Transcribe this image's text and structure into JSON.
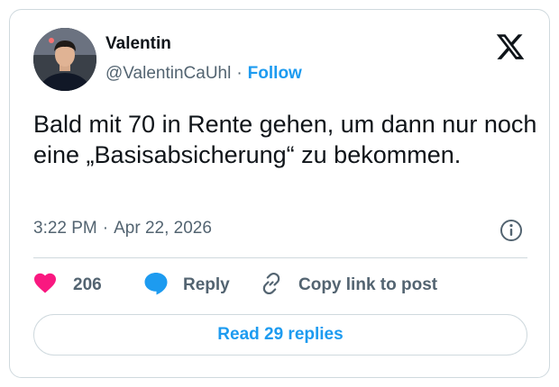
{
  "author": {
    "name": "Valentin",
    "handle": "@ValentinCaUhl",
    "separator": "·",
    "follow_label": "Follow"
  },
  "tweet": {
    "text": "Bald mit 70 in Rente gehen, um dann nur noch eine „Basisabsicherung“ zu bekommen.",
    "time": "3:22 PM",
    "separator": "·",
    "date": "Apr 22, 2026"
  },
  "actions": {
    "likes_count": "206",
    "reply_label": "Reply",
    "copy_label": "Copy link to post"
  },
  "read_replies_label": "Read 29 replies",
  "icons": {
    "brand": "x-logo-icon",
    "info": "info-icon",
    "like": "heart-icon",
    "reply": "speech-bubble-icon",
    "copy": "link-icon"
  },
  "colors": {
    "accent": "#1d9bf0",
    "like": "#f91880",
    "text": "#0f1419",
    "secondary": "#536471",
    "border": "#cfd9de"
  }
}
